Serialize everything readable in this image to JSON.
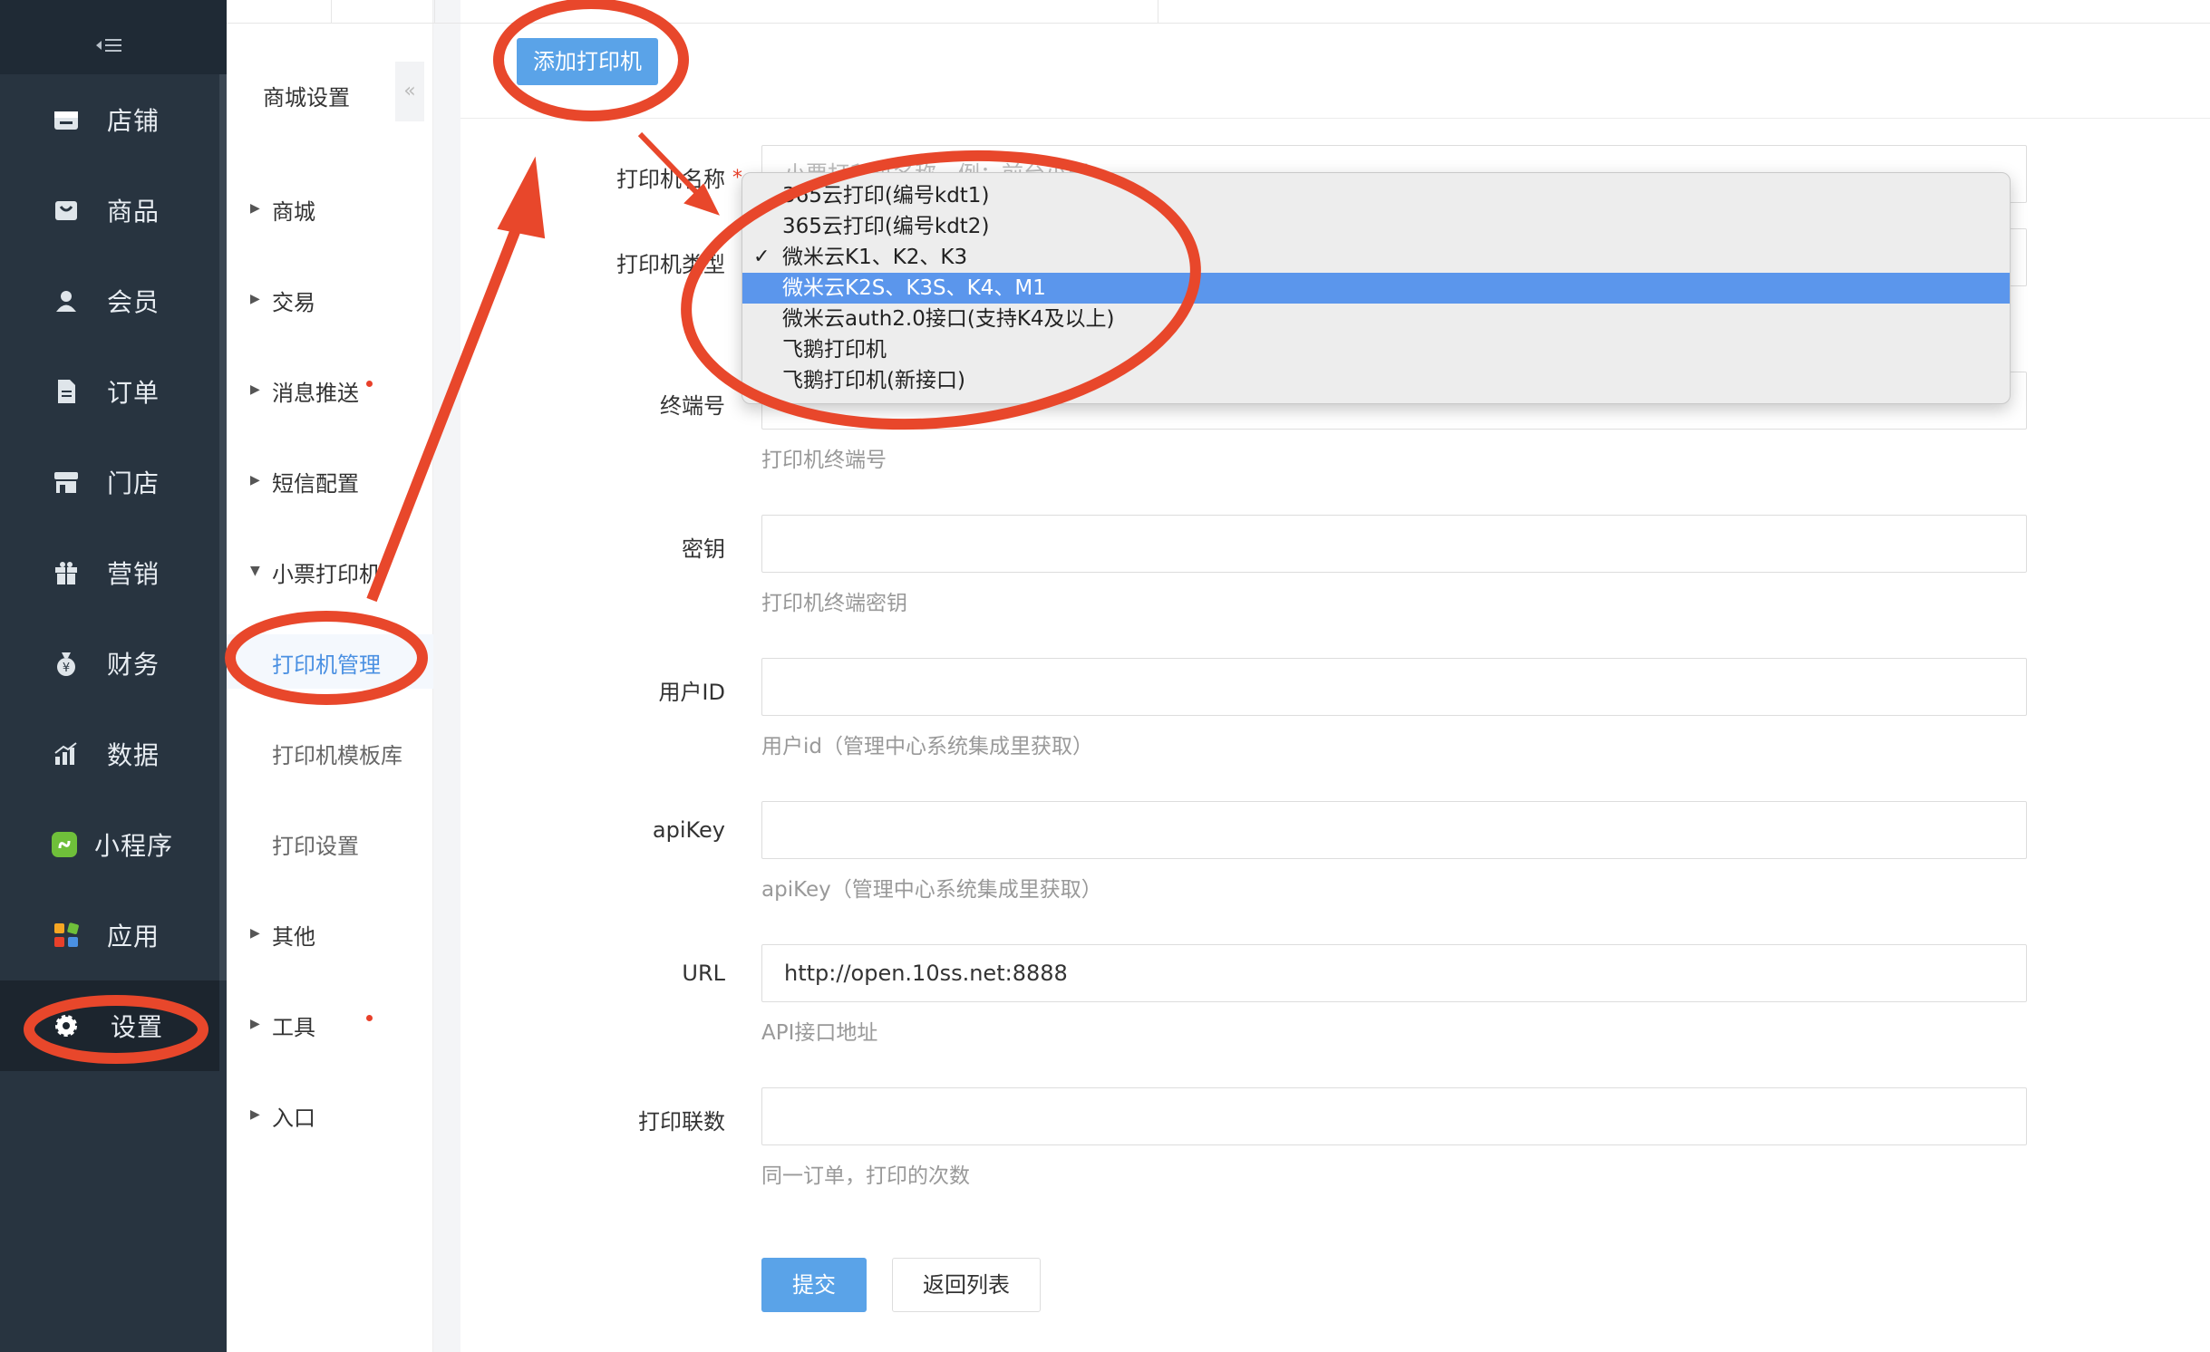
{
  "sidebar": {
    "collapse_icon": "menu-collapse-icon",
    "items": [
      {
        "label": "店铺",
        "icon": "store-icon"
      },
      {
        "label": "商品",
        "icon": "shopping-bag-icon"
      },
      {
        "label": "会员",
        "icon": "user-icon"
      },
      {
        "label": "订单",
        "icon": "document-icon"
      },
      {
        "label": "门店",
        "icon": "shop-front-icon"
      },
      {
        "label": "营销",
        "icon": "gift-icon"
      },
      {
        "label": "财务",
        "icon": "money-bag-icon"
      },
      {
        "label": "数据",
        "icon": "chart-icon"
      },
      {
        "label": "小程序",
        "icon": "mini-program-icon"
      },
      {
        "label": "应用",
        "icon": "apps-grid-icon"
      },
      {
        "label": "设置",
        "icon": "gear-icon"
      }
    ],
    "active": "设置"
  },
  "submenu": {
    "title": "商城设置",
    "fold_icon": "double-chevron-left-icon",
    "items": [
      {
        "label": "商城",
        "type": "group"
      },
      {
        "label": "交易",
        "type": "group"
      },
      {
        "label": "消息推送",
        "type": "group",
        "dot": true
      },
      {
        "label": "短信配置",
        "type": "group"
      },
      {
        "label": "小票打印机",
        "type": "group-open"
      },
      {
        "label": "打印机管理",
        "type": "child",
        "selected": true
      },
      {
        "label": "打印机模板库",
        "type": "child"
      },
      {
        "label": "打印设置",
        "type": "child"
      },
      {
        "label": "其他",
        "type": "group"
      },
      {
        "label": "工具",
        "type": "group",
        "dot": true
      },
      {
        "label": "入口",
        "type": "group"
      }
    ]
  },
  "main": {
    "add_button": "添加打印机",
    "form": {
      "name_label": "打印机名称",
      "name_placeholder": "小票打印机名称，例：前台小票",
      "type_label": "打印机类型",
      "terminal_label": "终端号",
      "terminal_hint": "打印机终端号",
      "secret_label": "密钥",
      "secret_hint": "打印机终端密钥",
      "userid_label": "用户ID",
      "userid_hint": "用户id（管理中心系统集成里获取）",
      "apikey_label": "apiKey",
      "apikey_hint": "apiKey（管理中心系统集成里获取）",
      "url_label": "URL",
      "url_value": "http://open.10ss.net:8888",
      "url_hint": "API接口地址",
      "copies_label": "打印联数",
      "copies_hint": "同一订单，打印的次数",
      "submit": "提交",
      "back": "返回列表"
    },
    "type_dropdown": {
      "options": [
        "365云打印(编号kdt1)",
        "365云打印(编号kdt2)",
        "微米云K1、K2、K3",
        "微米云K2S、K3S、K4、M1",
        "微米云auth2.0接口(支持K4及以上)",
        "飞鹅打印机",
        "飞鹅打印机(新接口)"
      ],
      "checked": "微米云K1、K2、K3",
      "highlighted": "微米云K2S、K3S、K4、M1",
      "check_icon": "checkmark-icon"
    }
  },
  "colors": {
    "sidebar_bg": "#283440",
    "accent_blue": "#5aa3e8",
    "annotation_red": "#e8472b",
    "dropdown_highlight": "#5b96ec"
  }
}
